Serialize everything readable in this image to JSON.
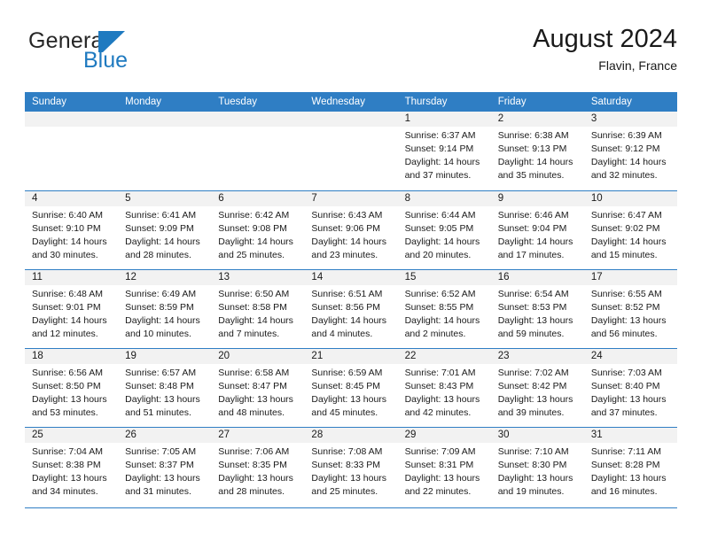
{
  "brand": {
    "name_part1": "General",
    "name_part2": "Blue",
    "flag_icon": "blue-flag-icon",
    "accent_color": "#1f7ac0"
  },
  "header": {
    "title": "August 2024",
    "subtitle": "Flavin, France"
  },
  "theme": {
    "header_blue": "#2f7ec4",
    "daynum_band": "#f2f2f2",
    "text": "#1a1a1a"
  },
  "calendar": {
    "weekday_headers": [
      "Sunday",
      "Monday",
      "Tuesday",
      "Wednesday",
      "Thursday",
      "Friday",
      "Saturday"
    ],
    "weeks": [
      [
        {
          "day": "",
          "sunrise": "",
          "sunset": "",
          "daylight_line1": "",
          "daylight_line2": ""
        },
        {
          "day": "",
          "sunrise": "",
          "sunset": "",
          "daylight_line1": "",
          "daylight_line2": ""
        },
        {
          "day": "",
          "sunrise": "",
          "sunset": "",
          "daylight_line1": "",
          "daylight_line2": ""
        },
        {
          "day": "",
          "sunrise": "",
          "sunset": "",
          "daylight_line1": "",
          "daylight_line2": ""
        },
        {
          "day": "1",
          "sunrise": "Sunrise: 6:37 AM",
          "sunset": "Sunset: 9:14 PM",
          "daylight_line1": "Daylight: 14 hours",
          "daylight_line2": "and 37 minutes."
        },
        {
          "day": "2",
          "sunrise": "Sunrise: 6:38 AM",
          "sunset": "Sunset: 9:13 PM",
          "daylight_line1": "Daylight: 14 hours",
          "daylight_line2": "and 35 minutes."
        },
        {
          "day": "3",
          "sunrise": "Sunrise: 6:39 AM",
          "sunset": "Sunset: 9:12 PM",
          "daylight_line1": "Daylight: 14 hours",
          "daylight_line2": "and 32 minutes."
        }
      ],
      [
        {
          "day": "4",
          "sunrise": "Sunrise: 6:40 AM",
          "sunset": "Sunset: 9:10 PM",
          "daylight_line1": "Daylight: 14 hours",
          "daylight_line2": "and 30 minutes."
        },
        {
          "day": "5",
          "sunrise": "Sunrise: 6:41 AM",
          "sunset": "Sunset: 9:09 PM",
          "daylight_line1": "Daylight: 14 hours",
          "daylight_line2": "and 28 minutes."
        },
        {
          "day": "6",
          "sunrise": "Sunrise: 6:42 AM",
          "sunset": "Sunset: 9:08 PM",
          "daylight_line1": "Daylight: 14 hours",
          "daylight_line2": "and 25 minutes."
        },
        {
          "day": "7",
          "sunrise": "Sunrise: 6:43 AM",
          "sunset": "Sunset: 9:06 PM",
          "daylight_line1": "Daylight: 14 hours",
          "daylight_line2": "and 23 minutes."
        },
        {
          "day": "8",
          "sunrise": "Sunrise: 6:44 AM",
          "sunset": "Sunset: 9:05 PM",
          "daylight_line1": "Daylight: 14 hours",
          "daylight_line2": "and 20 minutes."
        },
        {
          "day": "9",
          "sunrise": "Sunrise: 6:46 AM",
          "sunset": "Sunset: 9:04 PM",
          "daylight_line1": "Daylight: 14 hours",
          "daylight_line2": "and 17 minutes."
        },
        {
          "day": "10",
          "sunrise": "Sunrise: 6:47 AM",
          "sunset": "Sunset: 9:02 PM",
          "daylight_line1": "Daylight: 14 hours",
          "daylight_line2": "and 15 minutes."
        }
      ],
      [
        {
          "day": "11",
          "sunrise": "Sunrise: 6:48 AM",
          "sunset": "Sunset: 9:01 PM",
          "daylight_line1": "Daylight: 14 hours",
          "daylight_line2": "and 12 minutes."
        },
        {
          "day": "12",
          "sunrise": "Sunrise: 6:49 AM",
          "sunset": "Sunset: 8:59 PM",
          "daylight_line1": "Daylight: 14 hours",
          "daylight_line2": "and 10 minutes."
        },
        {
          "day": "13",
          "sunrise": "Sunrise: 6:50 AM",
          "sunset": "Sunset: 8:58 PM",
          "daylight_line1": "Daylight: 14 hours",
          "daylight_line2": "and 7 minutes."
        },
        {
          "day": "14",
          "sunrise": "Sunrise: 6:51 AM",
          "sunset": "Sunset: 8:56 PM",
          "daylight_line1": "Daylight: 14 hours",
          "daylight_line2": "and 4 minutes."
        },
        {
          "day": "15",
          "sunrise": "Sunrise: 6:52 AM",
          "sunset": "Sunset: 8:55 PM",
          "daylight_line1": "Daylight: 14 hours",
          "daylight_line2": "and 2 minutes."
        },
        {
          "day": "16",
          "sunrise": "Sunrise: 6:54 AM",
          "sunset": "Sunset: 8:53 PM",
          "daylight_line1": "Daylight: 13 hours",
          "daylight_line2": "and 59 minutes."
        },
        {
          "day": "17",
          "sunrise": "Sunrise: 6:55 AM",
          "sunset": "Sunset: 8:52 PM",
          "daylight_line1": "Daylight: 13 hours",
          "daylight_line2": "and 56 minutes."
        }
      ],
      [
        {
          "day": "18",
          "sunrise": "Sunrise: 6:56 AM",
          "sunset": "Sunset: 8:50 PM",
          "daylight_line1": "Daylight: 13 hours",
          "daylight_line2": "and 53 minutes."
        },
        {
          "day": "19",
          "sunrise": "Sunrise: 6:57 AM",
          "sunset": "Sunset: 8:48 PM",
          "daylight_line1": "Daylight: 13 hours",
          "daylight_line2": "and 51 minutes."
        },
        {
          "day": "20",
          "sunrise": "Sunrise: 6:58 AM",
          "sunset": "Sunset: 8:47 PM",
          "daylight_line1": "Daylight: 13 hours",
          "daylight_line2": "and 48 minutes."
        },
        {
          "day": "21",
          "sunrise": "Sunrise: 6:59 AM",
          "sunset": "Sunset: 8:45 PM",
          "daylight_line1": "Daylight: 13 hours",
          "daylight_line2": "and 45 minutes."
        },
        {
          "day": "22",
          "sunrise": "Sunrise: 7:01 AM",
          "sunset": "Sunset: 8:43 PM",
          "daylight_line1": "Daylight: 13 hours",
          "daylight_line2": "and 42 minutes."
        },
        {
          "day": "23",
          "sunrise": "Sunrise: 7:02 AM",
          "sunset": "Sunset: 8:42 PM",
          "daylight_line1": "Daylight: 13 hours",
          "daylight_line2": "and 39 minutes."
        },
        {
          "day": "24",
          "sunrise": "Sunrise: 7:03 AM",
          "sunset": "Sunset: 8:40 PM",
          "daylight_line1": "Daylight: 13 hours",
          "daylight_line2": "and 37 minutes."
        }
      ],
      [
        {
          "day": "25",
          "sunrise": "Sunrise: 7:04 AM",
          "sunset": "Sunset: 8:38 PM",
          "daylight_line1": "Daylight: 13 hours",
          "daylight_line2": "and 34 minutes."
        },
        {
          "day": "26",
          "sunrise": "Sunrise: 7:05 AM",
          "sunset": "Sunset: 8:37 PM",
          "daylight_line1": "Daylight: 13 hours",
          "daylight_line2": "and 31 minutes."
        },
        {
          "day": "27",
          "sunrise": "Sunrise: 7:06 AM",
          "sunset": "Sunset: 8:35 PM",
          "daylight_line1": "Daylight: 13 hours",
          "daylight_line2": "and 28 minutes."
        },
        {
          "day": "28",
          "sunrise": "Sunrise: 7:08 AM",
          "sunset": "Sunset: 8:33 PM",
          "daylight_line1": "Daylight: 13 hours",
          "daylight_line2": "and 25 minutes."
        },
        {
          "day": "29",
          "sunrise": "Sunrise: 7:09 AM",
          "sunset": "Sunset: 8:31 PM",
          "daylight_line1": "Daylight: 13 hours",
          "daylight_line2": "and 22 minutes."
        },
        {
          "day": "30",
          "sunrise": "Sunrise: 7:10 AM",
          "sunset": "Sunset: 8:30 PM",
          "daylight_line1": "Daylight: 13 hours",
          "daylight_line2": "and 19 minutes."
        },
        {
          "day": "31",
          "sunrise": "Sunrise: 7:11 AM",
          "sunset": "Sunset: 8:28 PM",
          "daylight_line1": "Daylight: 13 hours",
          "daylight_line2": "and 16 minutes."
        }
      ]
    ]
  }
}
